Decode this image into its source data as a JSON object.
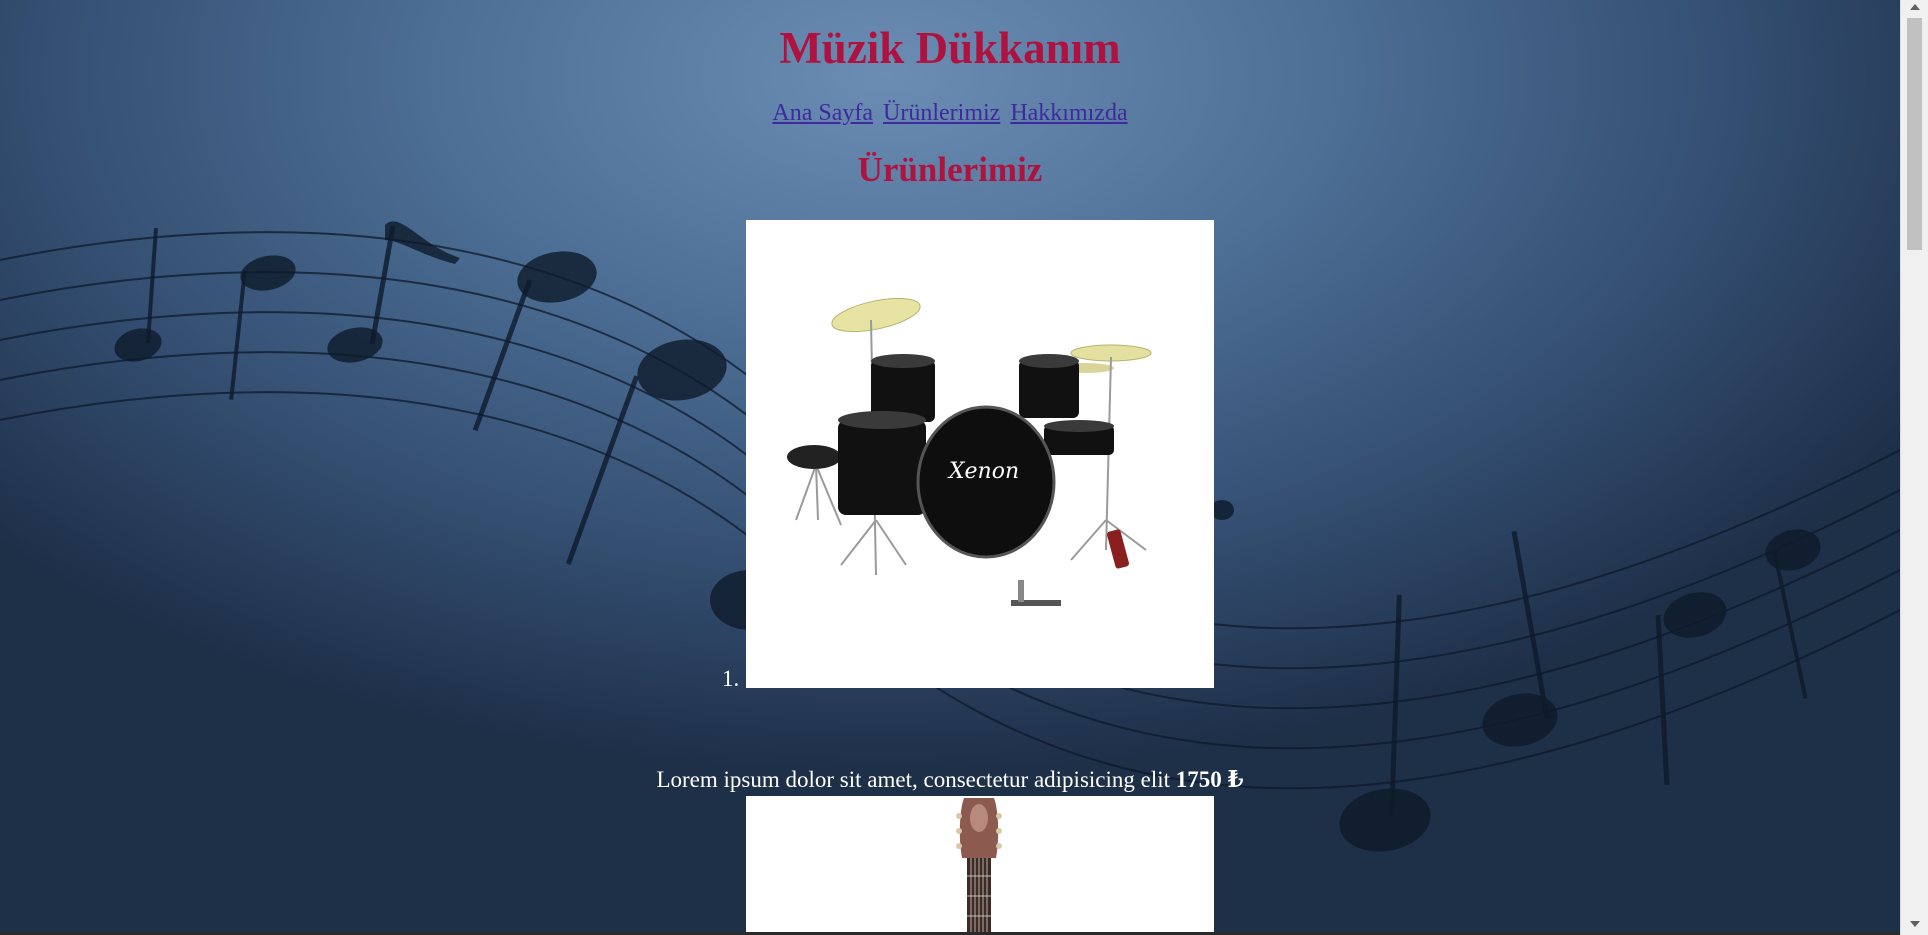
{
  "site": {
    "title": "Müzik Dükkanım"
  },
  "nav": {
    "links": [
      "Ana Sayfa",
      "Ürünlerimiz",
      "Hakkımızda"
    ]
  },
  "main": {
    "section_title": "Ürünlerimiz",
    "items": [
      {
        "number": "1.",
        "image_alt": "drum-kit",
        "brand_on_drum": "Xenon",
        "description": "Lorem ipsum dolor sit amet, consectetur adipisicing elit",
        "price": "1750 ₺"
      },
      {
        "image_alt": "classical-guitar"
      }
    ]
  },
  "colors": {
    "title": "#b0123f",
    "link": "#3d2a9e",
    "background_top": "#6b8db3",
    "background_bottom": "#1e2f48"
  }
}
